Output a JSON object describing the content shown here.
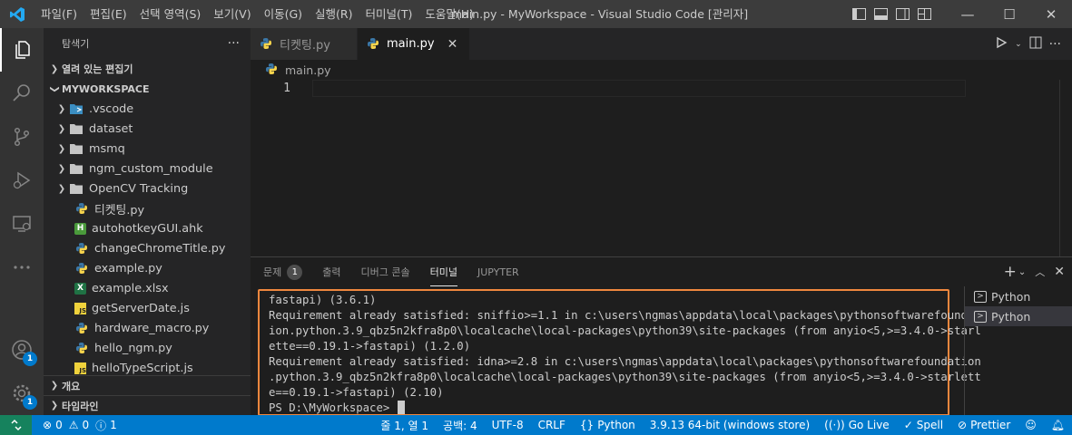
{
  "window": {
    "title": "main.py - MyWorkspace - Visual Studio Code [관리자]",
    "menu": [
      "파일(F)",
      "편집(E)",
      "선택 영역(S)",
      "보기(V)",
      "이동(G)",
      "실행(R)",
      "터미널(T)",
      "도움말(H)"
    ],
    "controls": {
      "minimize": "—",
      "maximize": "☐",
      "close": "✕"
    }
  },
  "activity_bar": {
    "accounts_badge": "1",
    "manage_badge": "1"
  },
  "sidebar": {
    "title": "탐색기",
    "more": "···",
    "open_editors": "열려 있는 편집기",
    "workspace": "MYWORKSPACE",
    "folders": [
      ".vscode",
      "dataset",
      "msmq",
      "ngm_custom_module",
      "OpenCV Tracking"
    ],
    "files": [
      {
        "name": "티켓팅.py",
        "icon": "python-icon"
      },
      {
        "name": "autohotkeyGUI.ahk",
        "icon": "ahk-icon"
      },
      {
        "name": "changeChromeTitle.py",
        "icon": "python-icon"
      },
      {
        "name": "example.py",
        "icon": "python-icon"
      },
      {
        "name": "example.xlsx",
        "icon": "excel-icon"
      },
      {
        "name": "getServerDate.js",
        "icon": "js-icon"
      },
      {
        "name": "hardware_macro.py",
        "icon": "python-icon"
      },
      {
        "name": "hello_ngm.py",
        "icon": "python-icon"
      },
      {
        "name": "helloTypeScript.js",
        "icon": "js-icon"
      }
    ],
    "outline": "개요",
    "timeline": "타임라인"
  },
  "editor": {
    "tabs": [
      {
        "label": "티켓팅.py",
        "active": false
      },
      {
        "label": "main.py",
        "active": true
      }
    ],
    "breadcrumb": "main.py",
    "line_number": "1"
  },
  "panel": {
    "tabs": {
      "problems": "문제",
      "problems_count": "1",
      "output": "출력",
      "debug_console": "디버그 콘솔",
      "terminal": "터미널",
      "jupyter": "JUPYTER"
    },
    "terminal_lines": [
      "fastapi) (3.6.1)",
      "Requirement already satisfied: sniffio>=1.1 in c:\\users\\ngmas\\appdata\\local\\packages\\pythonsoftwarefoundat",
      "ion.python.3.9_qbz5n2kfra8p0\\localcache\\local-packages\\python39\\site-packages (from anyio<5,>=3.4.0->starl",
      "ette==0.19.1->fastapi) (1.2.0)",
      "Requirement already satisfied: idna>=2.8 in c:\\users\\ngmas\\appdata\\local\\packages\\pythonsoftwarefoundation",
      ".python.3.9_qbz5n2kfra8p0\\localcache\\local-packages\\python39\\site-packages (from anyio<5,>=3.4.0->starlett",
      "e==0.19.1->fastapi) (2.10)"
    ],
    "prompt": "PS D:\\MyWorkspace> ",
    "terminals": [
      "Python",
      "Python"
    ]
  },
  "statusbar": {
    "errors": "0",
    "warnings": "0",
    "info": "1",
    "position": "줄 1, 열 1",
    "spaces": "공백: 4",
    "encoding": "UTF-8",
    "eol": "CRLF",
    "language": "Python",
    "interpreter": "3.9.13 64-bit (windows store)",
    "golive": "Go Live",
    "spell": "Spell",
    "prettier": "Prettier"
  },
  "colors": {
    "accent": "#007acc",
    "highlight_border": "#f0873e",
    "python_blue": "#3b78a8",
    "python_yellow": "#f7d44c"
  }
}
